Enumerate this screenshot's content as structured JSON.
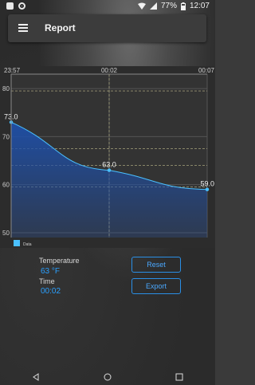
{
  "status_bar": {
    "battery": "77%",
    "time": "12:07"
  },
  "app_bar": {
    "title": "Report"
  },
  "chart_data": {
    "type": "line",
    "x_tick_labels": [
      "23:57",
      "00:02",
      "00:07"
    ],
    "x": [
      "23:57",
      "00:02",
      "00:07"
    ],
    "series": [
      {
        "name": "Data",
        "values": [
          73.0,
          63.0,
          59.0
        ],
        "color": "#4ac0ff"
      }
    ],
    "point_labels": [
      "73.0",
      "63.0",
      "59.0"
    ],
    "y_ticks": [
      50,
      60,
      70,
      80
    ],
    "ylim": [
      49,
      83
    ],
    "fill_color": "#1e4fa8",
    "grid": true,
    "limit_lines": [
      {
        "value": 79.5,
        "color": "#bdb88a"
      },
      {
        "value": 67.5,
        "color": "#bdb88a"
      },
      {
        "value": 64.0,
        "color": "#bdb88a"
      },
      {
        "value": 59.5,
        "color": "#bdb88a"
      }
    ],
    "legend_placement": "bottom-left"
  },
  "readout": {
    "temperature_label": "Temperature",
    "temperature_value": "63 °F",
    "time_label": "Time",
    "time_value": "00:02"
  },
  "buttons": {
    "reset": "Reset",
    "export": "Export"
  },
  "colors": {
    "accent": "#2a8fe6",
    "readout": "#2aa0ff"
  }
}
